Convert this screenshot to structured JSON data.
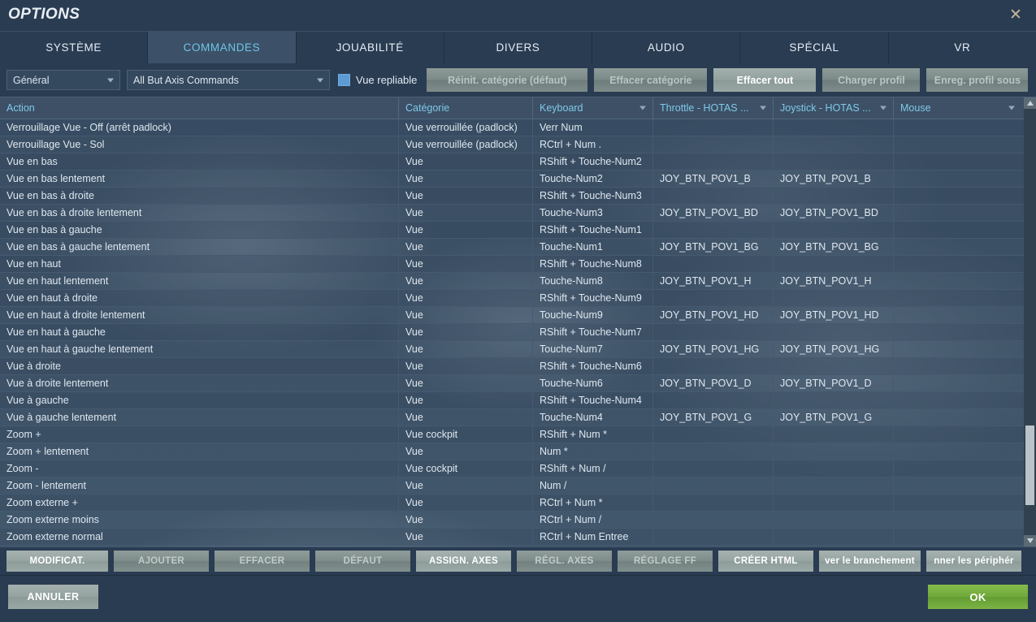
{
  "window": {
    "title": "OPTIONS",
    "close_icon": "close-icon"
  },
  "tabs": [
    {
      "label": "SYSTÈME",
      "active": false
    },
    {
      "label": "COMMANDES",
      "active": true
    },
    {
      "label": "JOUABILITÉ",
      "active": false
    },
    {
      "label": "DIVERS",
      "active": false
    },
    {
      "label": "AUDIO",
      "active": false
    },
    {
      "label": "SPÉCIAL",
      "active": false
    },
    {
      "label": "VR",
      "active": false
    }
  ],
  "filterbar": {
    "category_select": "Général",
    "command_select": "All But Axis Commands",
    "collapsible_checkbox_label": "Vue repliable",
    "collapsible_checked": true,
    "buttons": [
      {
        "label": "Réinit. catégorie (défaut)",
        "enabled": false
      },
      {
        "label": "Effacer catégorie",
        "enabled": false
      },
      {
        "label": "Effacer tout",
        "enabled": true
      },
      {
        "label": "Charger profil",
        "enabled": false
      },
      {
        "label": "Enreg. profil sous",
        "enabled": false
      }
    ]
  },
  "table": {
    "columns": [
      {
        "label": "Action",
        "has_caret": false
      },
      {
        "label": "Catégorie",
        "has_caret": false
      },
      {
        "label": "Keyboard",
        "has_caret": true
      },
      {
        "label": "Throttle - HOTAS ...",
        "has_caret": true
      },
      {
        "label": "Joystick - HOTAS ...",
        "has_caret": true
      },
      {
        "label": "Mouse",
        "has_caret": true
      }
    ],
    "rows": [
      [
        "Verrouillage Vue - Off (arrêt padlock)",
        "Vue verrouillée (padlock)",
        "Verr Num",
        "",
        "",
        ""
      ],
      [
        "Verrouillage Vue - Sol",
        "Vue verrouillée (padlock)",
        "RCtrl + Num .",
        "",
        "",
        ""
      ],
      [
        "Vue en bas",
        "Vue",
        "RShift + Touche-Num2",
        "",
        "",
        ""
      ],
      [
        "Vue en bas lentement",
        "Vue",
        "Touche-Num2",
        "JOY_BTN_POV1_B",
        "JOY_BTN_POV1_B",
        ""
      ],
      [
        "Vue en bas à droite",
        "Vue",
        "RShift + Touche-Num3",
        "",
        "",
        ""
      ],
      [
        "Vue en bas à droite lentement",
        "Vue",
        "Touche-Num3",
        "JOY_BTN_POV1_BD",
        "JOY_BTN_POV1_BD",
        ""
      ],
      [
        "Vue en bas à gauche",
        "Vue",
        "RShift + Touche-Num1",
        "",
        "",
        ""
      ],
      [
        "Vue en bas à gauche lentement",
        "Vue",
        "Touche-Num1",
        "JOY_BTN_POV1_BG",
        "JOY_BTN_POV1_BG",
        ""
      ],
      [
        "Vue en haut",
        "Vue",
        "RShift + Touche-Num8",
        "",
        "",
        ""
      ],
      [
        "Vue en haut lentement",
        "Vue",
        "Touche-Num8",
        "JOY_BTN_POV1_H",
        "JOY_BTN_POV1_H",
        ""
      ],
      [
        "Vue en haut à droite",
        "Vue",
        "RShift + Touche-Num9",
        "",
        "",
        ""
      ],
      [
        "Vue en haut à droite lentement",
        "Vue",
        "Touche-Num9",
        "JOY_BTN_POV1_HD",
        "JOY_BTN_POV1_HD",
        ""
      ],
      [
        "Vue en haut à gauche",
        "Vue",
        "RShift + Touche-Num7",
        "",
        "",
        ""
      ],
      [
        "Vue en haut à gauche lentement",
        "Vue",
        "Touche-Num7",
        "JOY_BTN_POV1_HG",
        "JOY_BTN_POV1_HG",
        ""
      ],
      [
        "Vue à droite",
        "Vue",
        "RShift + Touche-Num6",
        "",
        "",
        ""
      ],
      [
        "Vue à droite lentement",
        "Vue",
        "Touche-Num6",
        "JOY_BTN_POV1_D",
        "JOY_BTN_POV1_D",
        ""
      ],
      [
        "Vue à gauche",
        "Vue",
        "RShift + Touche-Num4",
        "",
        "",
        ""
      ],
      [
        "Vue à gauche lentement",
        "Vue",
        "Touche-Num4",
        "JOY_BTN_POV1_G",
        "JOY_BTN_POV1_G",
        ""
      ],
      [
        "Zoom +",
        "Vue cockpit",
        "RShift + Num *",
        "",
        "",
        ""
      ],
      [
        "Zoom + lentement",
        "Vue",
        "Num *",
        "",
        "",
        ""
      ],
      [
        "Zoom -",
        "Vue cockpit",
        "RShift + Num /",
        "",
        "",
        ""
      ],
      [
        "Zoom - lentement",
        "Vue",
        "Num /",
        "",
        "",
        ""
      ],
      [
        "Zoom externe +",
        "Vue",
        "RCtrl + Num *",
        "",
        "",
        ""
      ],
      [
        "Zoom externe moins",
        "Vue",
        "RCtrl + Num /",
        "",
        "",
        ""
      ],
      [
        "Zoom externe normal",
        "Vue",
        "RCtrl + Num Entree",
        "",
        "",
        ""
      ]
    ]
  },
  "actionbar": {
    "buttons": [
      {
        "label": "MODIFICAT.",
        "enabled": true,
        "width": 125
      },
      {
        "label": "AJOUTER",
        "enabled": false,
        "width": 117
      },
      {
        "label": "EFFACER",
        "enabled": false,
        "width": 117
      },
      {
        "label": "DÉFAUT",
        "enabled": false,
        "width": 117
      },
      {
        "label": "ASSIGN. AXES",
        "enabled": true,
        "width": 117
      },
      {
        "label": "RÉGL. AXES",
        "enabled": false,
        "width": 117
      },
      {
        "label": "RÉGLAGE FF",
        "enabled": false,
        "width": 117
      },
      {
        "label": "CRÉER HTML",
        "enabled": true,
        "width": 117
      },
      {
        "label": "ver le branchement",
        "enabled": true,
        "width": 125
      },
      {
        "label": "nner les périphér",
        "enabled": true,
        "width": 117
      }
    ]
  },
  "footer": {
    "cancel_label": "ANNULER",
    "ok_label": "OK"
  },
  "colors": {
    "accent_cyan": "#6ec6e8",
    "ok_green": "#6fa83b",
    "panel_bg": "#2a3c52",
    "header_bg": "#3d5066",
    "checkbox_blue": "#5d9bd4"
  }
}
